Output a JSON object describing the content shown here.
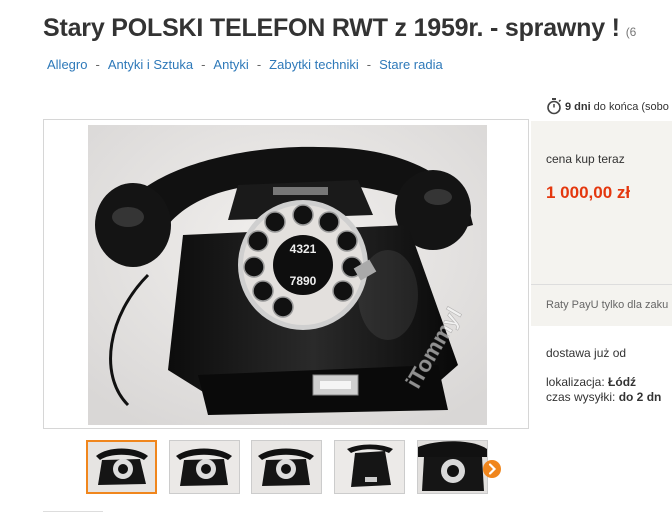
{
  "title": {
    "main": "Stary POLSKI TELEFON RWT z 1959r. - sprawny !",
    "extra": "(6"
  },
  "breadcrumbs": [
    "Allegro",
    "Antyki i Sztuka",
    "Antyki",
    "Zabytki techniki",
    "Stare radia"
  ],
  "time_left": {
    "value": "9 dni",
    "suffix": "do końca (sobo",
    "icon": "stopwatch-icon"
  },
  "gallery": {
    "watermark": "iTommyl",
    "thumb_count": 5,
    "active_thumb": 0
  },
  "price_panel": {
    "label": "cena kup teraz",
    "price": "1 000,00 zł",
    "raty": "Raty PayU tylko dla zaku"
  },
  "delivery": {
    "label": "dostawa już od"
  },
  "location": {
    "label": "lokalizacja:",
    "value": "Łódź",
    "shipping_label": "czas wysyłki:",
    "shipping_value": "do 2 dn"
  },
  "colors": {
    "link": "#2e79b9",
    "price": "#e4370e",
    "accent": "#f0861d",
    "panel": "#f4f3ef"
  }
}
